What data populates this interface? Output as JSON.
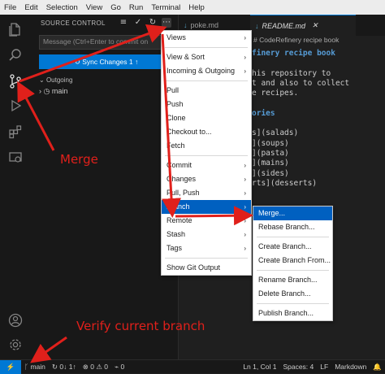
{
  "menubar": [
    "File",
    "Edit",
    "Selection",
    "View",
    "Go",
    "Run",
    "Terminal",
    "Help"
  ],
  "sidebar": {
    "title": "SOURCE CONTROL",
    "commit_placeholder": "Message (Ctrl+Enter to commit on",
    "sync_label": "↻ Sync Changes 1 ↑",
    "section": "Outgoing",
    "branch": "main"
  },
  "tabs": [
    {
      "label": "poke.md"
    },
    {
      "label": "README.md"
    }
  ],
  "breadcrumb": "# CodeRefinery recipe book",
  "code_lines": [
    "finery recipe book",
    "",
    "his repository to",
    "t and also to collect",
    "e recipes.",
    "",
    "ories",
    "",
    "s](salads)",
    "](soups)",
    "](pasta)",
    "](mains)",
    "](sides)",
    "rts](desserts)"
  ],
  "main_menu": [
    {
      "label": "Views",
      "sub": true
    },
    "sep",
    {
      "label": "View & Sort",
      "sub": true
    },
    {
      "label": "Incoming & Outgoing",
      "sub": true
    },
    "sep",
    {
      "label": "Pull"
    },
    {
      "label": "Push"
    },
    {
      "label": "Clone"
    },
    {
      "label": "Checkout to..."
    },
    {
      "label": "Fetch"
    },
    "sep",
    {
      "label": "Commit",
      "sub": true
    },
    {
      "label": "Changes",
      "sub": true
    },
    {
      "label": "Pull, Push",
      "sub": true
    },
    {
      "label": "Branch",
      "sub": true,
      "hl": true
    },
    {
      "label": "Remote",
      "sub": true
    },
    {
      "label": "Stash",
      "sub": true
    },
    {
      "label": "Tags",
      "sub": true
    },
    "sep",
    {
      "label": "Show Git Output"
    }
  ],
  "branch_menu": [
    {
      "label": "Merge...",
      "hl": true
    },
    {
      "label": "Rebase Branch..."
    },
    "sep",
    {
      "label": "Create Branch..."
    },
    {
      "label": "Create Branch From..."
    },
    "sep",
    {
      "label": "Rename Branch..."
    },
    {
      "label": "Delete Branch..."
    },
    "sep",
    {
      "label": "Publish Branch..."
    }
  ],
  "status": {
    "branch": "main",
    "sync": "0↓ 1↑",
    "errors": "0",
    "warnings": "0",
    "ports": "0",
    "position": "Ln 1, Col 1",
    "spaces": "Spaces: 4",
    "eol": "LF",
    "language": "Markdown"
  },
  "annotations": {
    "merge": "Merge",
    "verify": "Verify current branch"
  },
  "colors": {
    "accent": "#0078d4",
    "annotation": "#e0201b",
    "menu_highlight": "#0060c0"
  }
}
